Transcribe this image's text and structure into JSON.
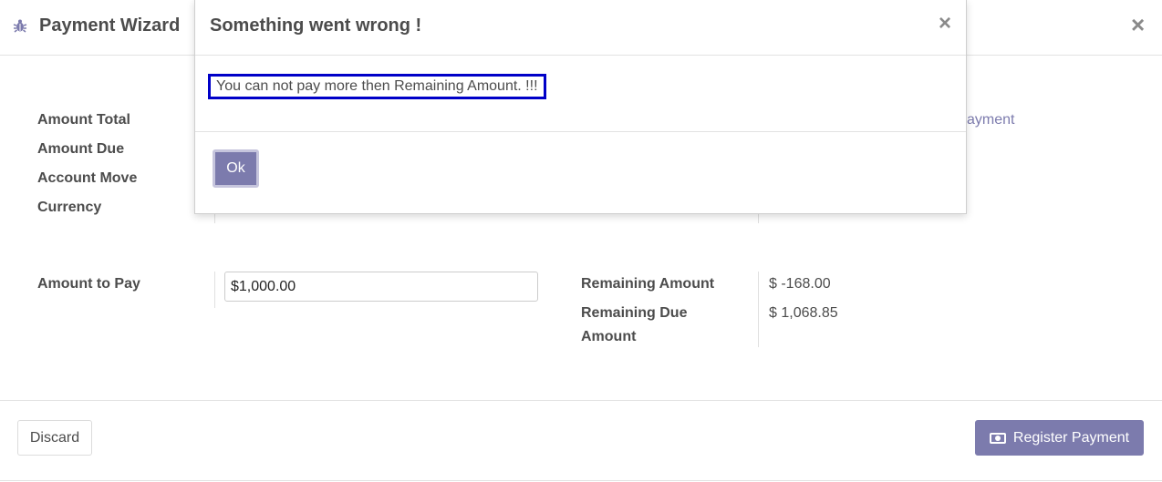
{
  "wizard": {
    "title": "Payment Wizard",
    "close_glyph": "×"
  },
  "form": {
    "labels": {
      "amount_total": "Amount Total",
      "amount_due": "Amount Due",
      "account_move": "Account Move",
      "currency": "Currency",
      "amount_to_pay": "Amount to Pay",
      "remaining_amount": "Remaining Amount",
      "remaining_due_line1": "Remaining Due",
      "remaining_due_line2": "Amount"
    },
    "amount_to_pay_value": "$1,000.00",
    "remaining_amount_value": "$ -168.00",
    "remaining_due_value": "$ 1,068.85",
    "partial_link_text": "ayment"
  },
  "footer": {
    "discard_label": "Discard",
    "register_label": "Register Payment"
  },
  "dialog": {
    "title": "Something went wrong !",
    "close_glyph": "×",
    "message": "You can not pay more then Remaining Amount. !!!",
    "ok_label": "Ok"
  },
  "colors": {
    "accent": "#7c7bad",
    "highlight_border": "#0000c8"
  },
  "icons": {
    "wizard": "bug-icon",
    "register": "money-icon"
  }
}
